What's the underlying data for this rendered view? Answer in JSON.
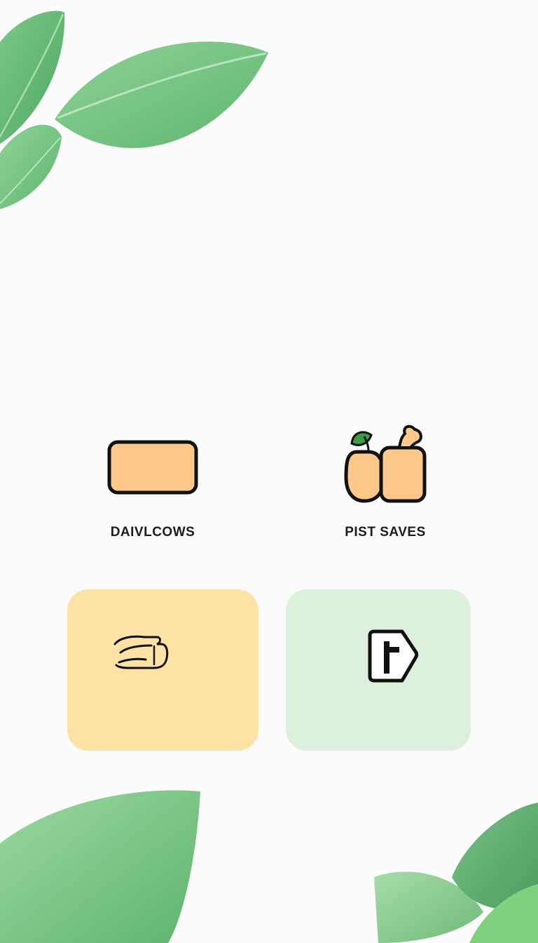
{
  "tiles": [
    {
      "label": "DAIVLCOWS",
      "icon": "card-icon",
      "background": "#fdfcfc"
    },
    {
      "label": "PIST SAVES",
      "icon": "produce-basket-icon",
      "background": "#fdfcfc"
    },
    {
      "label": "",
      "icon": "hand-icon",
      "background": "#fde2a6"
    },
    {
      "label": "",
      "icon": "tag-icon",
      "background": "#dcf0dd"
    }
  ],
  "colors": {
    "background": "#fdfcfc",
    "icon_fill": "#fcc98a",
    "icon_stroke": "#111111",
    "leaf_green": "#6cc07a",
    "leaf_light": "#9fd8a3"
  }
}
